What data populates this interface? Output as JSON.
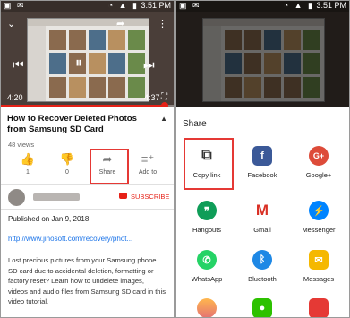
{
  "status": {
    "time": "3:51 PM"
  },
  "player": {
    "elapsed": "4:20",
    "duration": "4:37"
  },
  "video": {
    "title": "How to Recover Deleted Photos from Samsung SD Card",
    "views": "48 views"
  },
  "actions": [
    {
      "count": "1",
      "icon": "thumbs-up-icon"
    },
    {
      "count": "0",
      "icon": "thumbs-down-icon"
    },
    {
      "label": "Share",
      "icon": "share-arrow-icon"
    },
    {
      "label": "Add to",
      "icon": "playlist-add-icon"
    }
  ],
  "channel": {
    "subscribe_label": "SUBSCRIBE"
  },
  "description": {
    "published": "Published on Jan 9, 2018",
    "link": "http://www.jihosoft.com/recovery/phot...",
    "text": "Lost precious pictures from your Samsung phone SD card due to accidental deletion, formatting or factory reset? Learn how to undelete images, videos and audio files from Samsung SD card in this video tutorial."
  },
  "share_sheet": {
    "title": "Share",
    "apps": [
      {
        "label": "Copy link",
        "icon": "copy-link-icon",
        "color": "#ffffff"
      },
      {
        "label": "Facebook",
        "icon": "facebook-icon",
        "color": "#3b5998"
      },
      {
        "label": "Google+",
        "icon": "google-plus-icon",
        "color": "#dd4b39"
      },
      {
        "label": "Hangouts",
        "icon": "hangouts-icon",
        "color": "#0f9d58"
      },
      {
        "label": "Gmail",
        "icon": "gmail-icon",
        "color": "#ffffff"
      },
      {
        "label": "Messenger",
        "icon": "messenger-icon",
        "color": "#0084ff"
      },
      {
        "label": "WhatsApp",
        "icon": "whatsapp-icon",
        "color": "#25d366"
      },
      {
        "label": "Bluetooth",
        "icon": "bluetooth-icon",
        "color": "#1e88e5"
      },
      {
        "label": "Messages",
        "icon": "messages-icon",
        "color": "#f5b800"
      }
    ]
  },
  "colors": {
    "accent_red": "#e62117",
    "highlight": "#e53935",
    "link": "#1a73e8"
  }
}
